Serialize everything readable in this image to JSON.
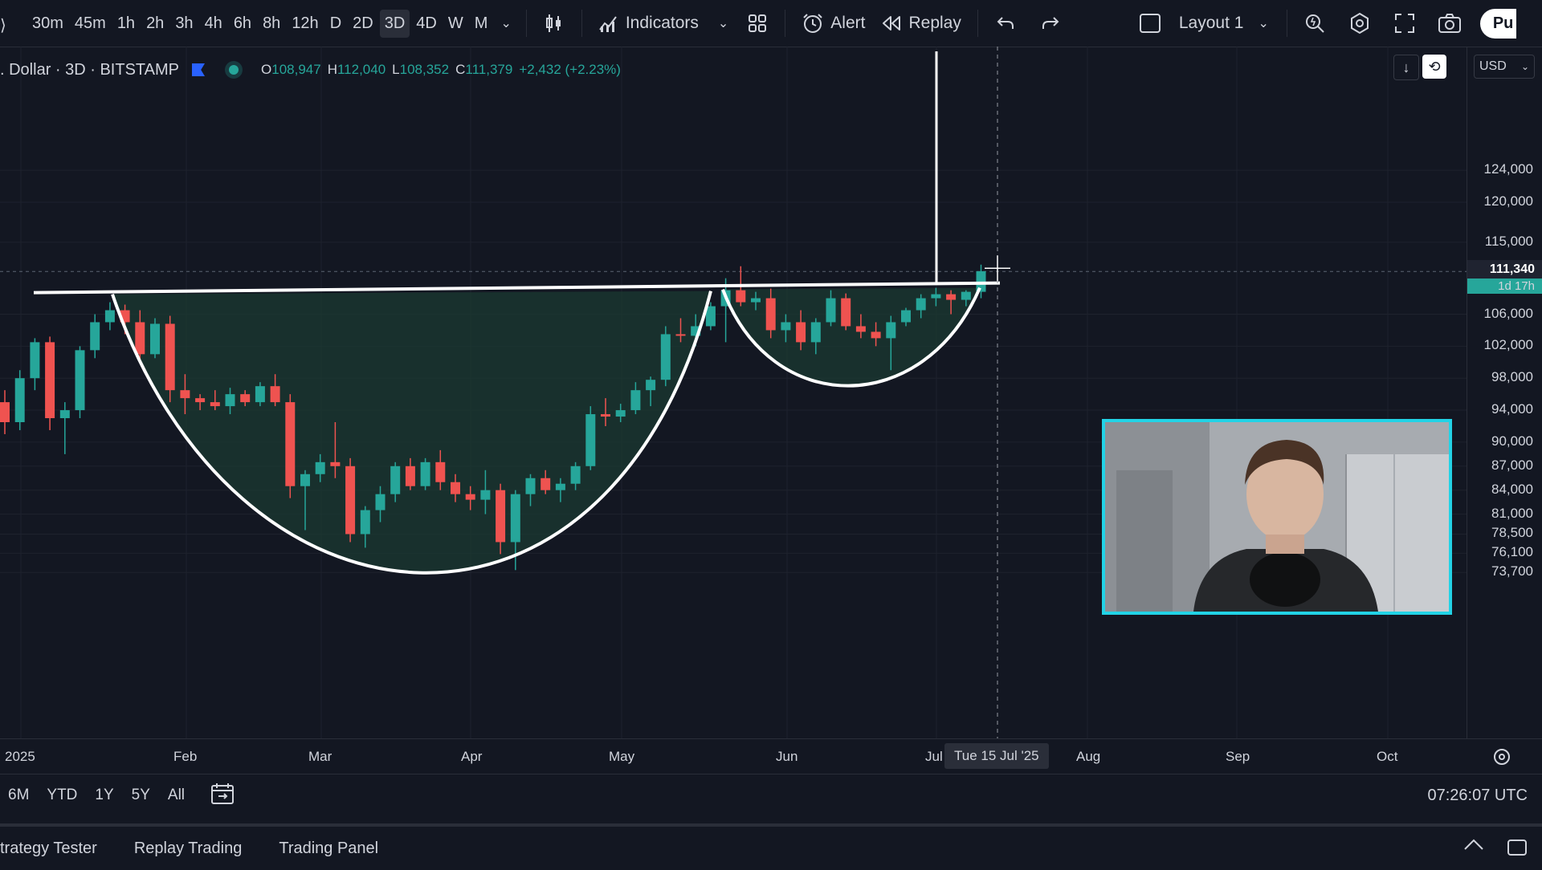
{
  "toolbar": {
    "timeframes": [
      "30m",
      "45m",
      "1h",
      "2h",
      "3h",
      "4h",
      "6h",
      "8h",
      "12h",
      "D",
      "2D",
      "3D",
      "4D",
      "W",
      "M"
    ],
    "active_timeframe": "3D",
    "indicators_label": "Indicators",
    "alert_label": "Alert",
    "replay_label": "Replay",
    "layout_label": "Layout 1",
    "publish_label": "Pu"
  },
  "symbol": {
    "name": ". Dollar · 3D · BITSTAMP",
    "open_label": "O",
    "open": "108,947",
    "high_label": "H",
    "high": "112,040",
    "low_label": "L",
    "low": "108,352",
    "close_label": "C",
    "close": "111,379",
    "change": "+2,432 (+2.23%)"
  },
  "price_axis": {
    "currency": "USD",
    "labels": [
      "124,000",
      "120,000",
      "115,000",
      "106,000",
      "102,000",
      "98,000",
      "94,000",
      "90,000",
      "87,000",
      "84,000",
      "81,000",
      "78,500",
      "76,100",
      "73,700"
    ],
    "current_price": "111,340",
    "countdown": "1d 17h"
  },
  "time_axis": {
    "labels": [
      "2025",
      "Feb",
      "Mar",
      "Apr",
      "May",
      "Jun",
      "Jul",
      "Aug",
      "Sep",
      "Oct"
    ],
    "crosshair_date": "Tue 15 Jul '25"
  },
  "ranges": {
    "buttons": [
      "6M",
      "YTD",
      "1Y",
      "5Y",
      "All"
    ],
    "clock": "07:26:07 UTC"
  },
  "bottom_tabs": [
    "trategy Tester",
    "Replay Trading",
    "Trading Panel"
  ],
  "colors": {
    "background": "#131722",
    "up": "#26a69a",
    "down": "#ef5350",
    "webcam_border": "#22d3e6",
    "pattern_fill": "#1b3a31"
  },
  "chart_data": {
    "type": "candlestick",
    "title": ". Dollar · 3D · BITSTAMP",
    "ylim": [
      72000,
      126000
    ],
    "price_ticks": [
      124000,
      120000,
      115000,
      106000,
      102000,
      98000,
      94000,
      90000,
      87000,
      84000,
      81000,
      78500,
      76100,
      73700
    ],
    "resistance_level": 109500,
    "candles": [
      {
        "o": 95000,
        "h": 96500,
        "l": 91000,
        "c": 92500
      },
      {
        "o": 92500,
        "h": 99000,
        "l": 91500,
        "c": 98000
      },
      {
        "o": 98000,
        "h": 103000,
        "l": 96500,
        "c": 102500
      },
      {
        "o": 102500,
        "h": 103200,
        "l": 91500,
        "c": 93000
      },
      {
        "o": 93000,
        "h": 95000,
        "l": 88500,
        "c": 94000
      },
      {
        "o": 94000,
        "h": 102000,
        "l": 93000,
        "c": 101500
      },
      {
        "o": 101500,
        "h": 106000,
        "l": 100500,
        "c": 105000
      },
      {
        "o": 105000,
        "h": 107500,
        "l": 104000,
        "c": 106500
      },
      {
        "o": 106500,
        "h": 107200,
        "l": 103500,
        "c": 105000
      },
      {
        "o": 105000,
        "h": 106500,
        "l": 100000,
        "c": 101000
      },
      {
        "o": 101000,
        "h": 105500,
        "l": 100500,
        "c": 104800
      },
      {
        "o": 104800,
        "h": 105800,
        "l": 95000,
        "c": 96500
      },
      {
        "o": 96500,
        "h": 98500,
        "l": 93500,
        "c": 95500
      },
      {
        "o": 95500,
        "h": 96000,
        "l": 94000,
        "c": 95000
      },
      {
        "o": 95000,
        "h": 96500,
        "l": 94000,
        "c": 94500
      },
      {
        "o": 94500,
        "h": 96800,
        "l": 93500,
        "c": 96000
      },
      {
        "o": 96000,
        "h": 96500,
        "l": 94500,
        "c": 95000
      },
      {
        "o": 95000,
        "h": 97500,
        "l": 94500,
        "c": 97000
      },
      {
        "o": 97000,
        "h": 98500,
        "l": 94500,
        "c": 95000
      },
      {
        "o": 95000,
        "h": 96000,
        "l": 83000,
        "c": 84500
      },
      {
        "o": 84500,
        "h": 86500,
        "l": 79000,
        "c": 86000
      },
      {
        "o": 86000,
        "h": 88500,
        "l": 85000,
        "c": 87500
      },
      {
        "o": 87500,
        "h": 92500,
        "l": 85500,
        "c": 87000
      },
      {
        "o": 87000,
        "h": 88000,
        "l": 77500,
        "c": 78500
      },
      {
        "o": 78500,
        "h": 82000,
        "l": 76800,
        "c": 81500
      },
      {
        "o": 81500,
        "h": 84500,
        "l": 80000,
        "c": 83500
      },
      {
        "o": 83500,
        "h": 87500,
        "l": 82500,
        "c": 87000
      },
      {
        "o": 87000,
        "h": 88000,
        "l": 84000,
        "c": 84500
      },
      {
        "o": 84500,
        "h": 88000,
        "l": 84000,
        "c": 87500
      },
      {
        "o": 87500,
        "h": 89000,
        "l": 84000,
        "c": 85000
      },
      {
        "o": 85000,
        "h": 86000,
        "l": 82500,
        "c": 83500
      },
      {
        "o": 83500,
        "h": 84500,
        "l": 81500,
        "c": 82800
      },
      {
        "o": 82800,
        "h": 86500,
        "l": 81000,
        "c": 84000
      },
      {
        "o": 84000,
        "h": 84800,
        "l": 76000,
        "c": 77500
      },
      {
        "o": 77500,
        "h": 84000,
        "l": 74000,
        "c": 83500
      },
      {
        "o": 83500,
        "h": 86000,
        "l": 82000,
        "c": 85500
      },
      {
        "o": 85500,
        "h": 86500,
        "l": 83500,
        "c": 84000
      },
      {
        "o": 84000,
        "h": 85500,
        "l": 82500,
        "c": 84800
      },
      {
        "o": 84800,
        "h": 87500,
        "l": 84000,
        "c": 87000
      },
      {
        "o": 87000,
        "h": 94500,
        "l": 86500,
        "c": 93500
      },
      {
        "o": 93500,
        "h": 95500,
        "l": 92000,
        "c": 93200
      },
      {
        "o": 93200,
        "h": 94800,
        "l": 92500,
        "c": 94000
      },
      {
        "o": 94000,
        "h": 97500,
        "l": 93500,
        "c": 96500
      },
      {
        "o": 96500,
        "h": 98200,
        "l": 94500,
        "c": 97800
      },
      {
        "o": 97800,
        "h": 104500,
        "l": 97000,
        "c": 103500
      },
      {
        "o": 103500,
        "h": 105500,
        "l": 102500,
        "c": 103300
      },
      {
        "o": 103300,
        "h": 106000,
        "l": 102000,
        "c": 104500
      },
      {
        "o": 104500,
        "h": 107500,
        "l": 104000,
        "c": 107000
      },
      {
        "o": 107000,
        "h": 110500,
        "l": 102500,
        "c": 109000
      },
      {
        "o": 109000,
        "h": 112000,
        "l": 107000,
        "c": 107500
      },
      {
        "o": 107500,
        "h": 108800,
        "l": 106500,
        "c": 108000
      },
      {
        "o": 108000,
        "h": 109200,
        "l": 103000,
        "c": 104000
      },
      {
        "o": 104000,
        "h": 106000,
        "l": 102500,
        "c": 105000
      },
      {
        "o": 105000,
        "h": 106500,
        "l": 101500,
        "c": 102500
      },
      {
        "o": 102500,
        "h": 105500,
        "l": 101000,
        "c": 105000
      },
      {
        "o": 105000,
        "h": 109000,
        "l": 104500,
        "c": 108000
      },
      {
        "o": 108000,
        "h": 108600,
        "l": 104000,
        "c": 104500
      },
      {
        "o": 104500,
        "h": 106000,
        "l": 103000,
        "c": 103800
      },
      {
        "o": 103800,
        "h": 105000,
        "l": 102000,
        "c": 103000
      },
      {
        "o": 103000,
        "h": 105800,
        "l": 99000,
        "c": 105000
      },
      {
        "o": 105000,
        "h": 106800,
        "l": 104500,
        "c": 106500
      },
      {
        "o": 106500,
        "h": 108500,
        "l": 105500,
        "c": 108000
      },
      {
        "o": 108000,
        "h": 109300,
        "l": 107000,
        "c": 108500
      },
      {
        "o": 108500,
        "h": 109000,
        "l": 106000,
        "c": 107800
      },
      {
        "o": 107800,
        "h": 109000,
        "l": 107000,
        "c": 108800
      },
      {
        "o": 108800,
        "h": 112200,
        "l": 108000,
        "c": 111379
      }
    ]
  }
}
